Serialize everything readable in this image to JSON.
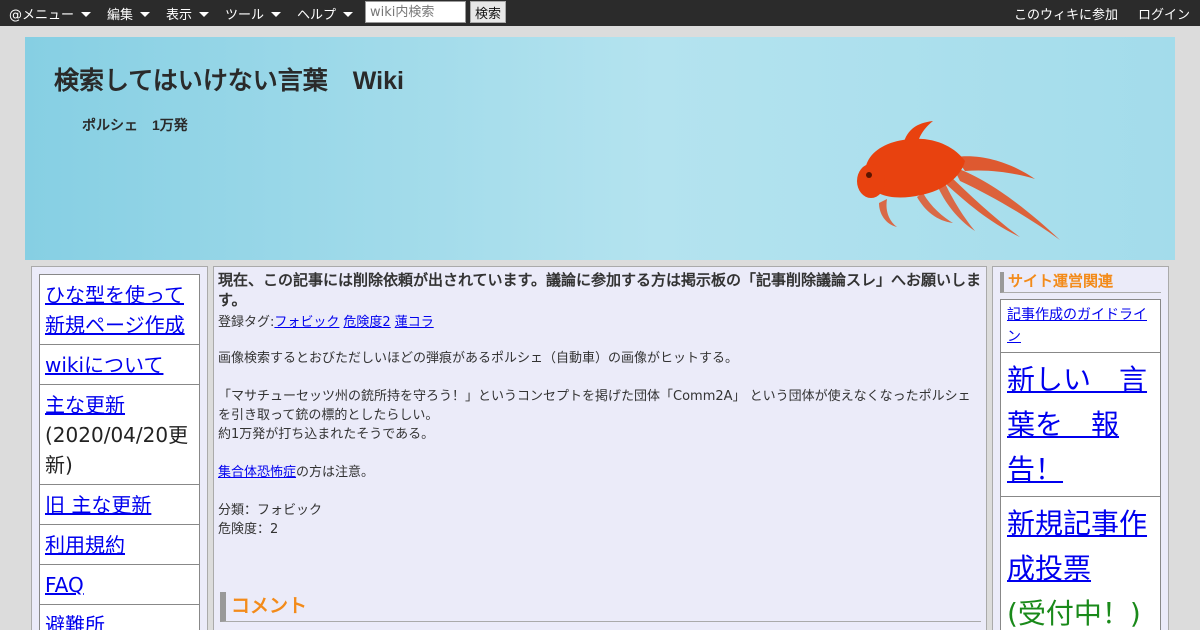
{
  "topbar": {
    "menu": "@メニュー",
    "edit": "編集",
    "view": "表示",
    "tools": "ツール",
    "help": "ヘルプ",
    "search_placeholder": "wiki内検索",
    "search_button": "検索",
    "join": "このウィキに参加",
    "login": "ログイン"
  },
  "header": {
    "title": "検索してはいけない言葉　Wiki",
    "subtitle": "ポルシェ　1万発"
  },
  "left_menu": {
    "items": [
      {
        "label": "ひな型を使って新規ページ作成"
      },
      {
        "label": "wikiについて"
      },
      {
        "label": "主な更新",
        "note": "(2020/04/20更新)"
      },
      {
        "label": "旧 主な更新"
      },
      {
        "label": "利用規約"
      },
      {
        "label": "FAQ"
      },
      {
        "label": "避難所"
      }
    ]
  },
  "main": {
    "notice": "現在、この記事には削除依頼が出されています。議論に参加する方は掲示板の「記事削除議論スレ」へお願いします。",
    "tags_label": "登録タグ:",
    "tags": [
      "フォビック",
      "危険度2",
      "蓮コラ"
    ],
    "p1": "画像検索するとおびただしいほどの弾痕があるポルシェ（自動車）の画像がヒットする。",
    "p2a": "「マサチューセッツ州の銃所持を守ろう！」というコンセプトを掲げた団体「Comm2A」 という団体が使えなくなったポルシェを引き取って銃の標的としたらしい。",
    "p2b": "約1万発が打ち込まれたそうである。",
    "p3_link": "集合体恐怖症",
    "p3_rest": "の方は注意。",
    "category": "分類：フォビック",
    "danger": "危険度：2",
    "comment_heading": "コメント"
  },
  "right": {
    "heading": "サイト運営関連",
    "guideline": "記事作成のガイドライン",
    "report": "新しい　言葉を　報告！",
    "vote": "新規記事作成投票",
    "vote_status": "(受付中！)"
  },
  "colors": {
    "topbar": "#2b2b2b",
    "header_gradient_start": "#86cfe3",
    "header_gradient_mid": "#b4e3ef",
    "goldfish": "#e8420f",
    "accent_heading": "#f38b1a",
    "link": "#0000ee",
    "panel_bg": "#ebebf9",
    "status_green": "#1a8a1a"
  },
  "icons": [
    "caret-down-icon",
    "goldfish-illustration"
  ]
}
